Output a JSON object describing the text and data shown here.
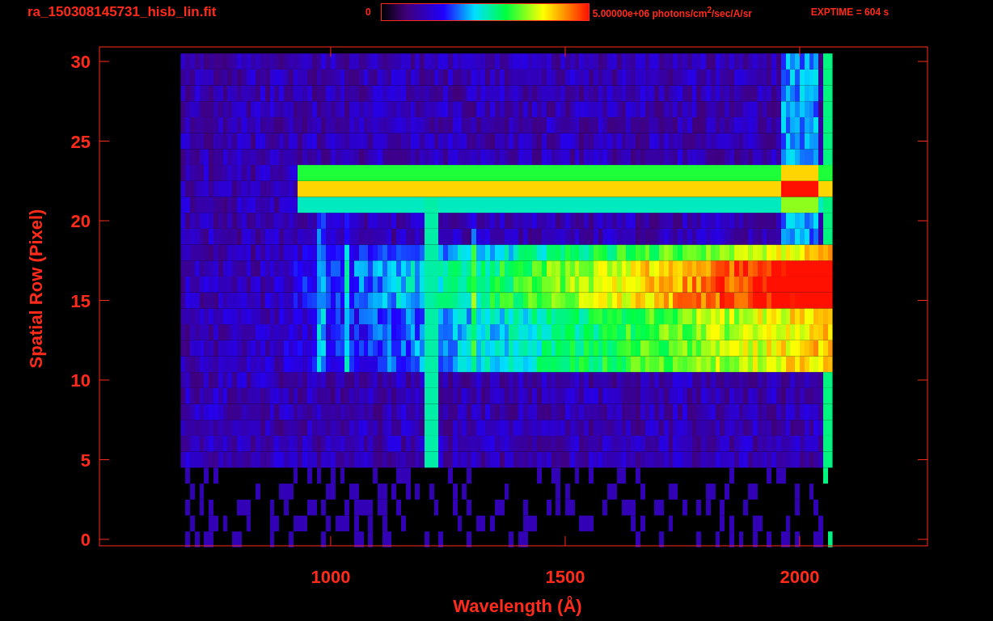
{
  "header": {
    "title": "ra_150308145731_hisb_lin.fit",
    "colorbar_min": "0",
    "colorbar_max": "5.00000e+06 photons/cm$^{2}$/sec/A/sr",
    "exposure": "EXPTIME = 604 s"
  },
  "y_axis": {
    "label": "Spatial Row (Pixel)",
    "ticks": [
      "30",
      "25",
      "20",
      "15",
      "10",
      "5",
      "0"
    ]
  },
  "x_axis": {
    "label": "Wavelength (Å)",
    "ticks": [
      "1000",
      "1500",
      "2000"
    ]
  }
}
